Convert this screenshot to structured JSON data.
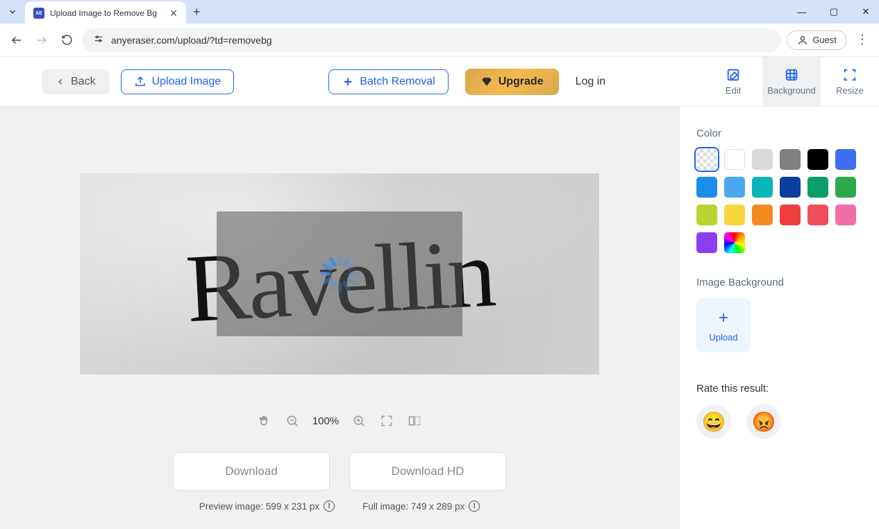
{
  "browser": {
    "tab_title": "Upload Image to Remove Bg",
    "favicon_text": "AE",
    "url": "anyeraser.com/upload/?td=removebg",
    "guest_label": "Guest"
  },
  "header": {
    "back_label": "Back",
    "upload_label": "Upload Image",
    "batch_label": "Batch Removal",
    "upgrade_label": "Upgrade",
    "login_label": "Log in",
    "tabs": {
      "edit": "Edit",
      "background": "Background",
      "resize": "Resize"
    }
  },
  "canvas": {
    "signature": "Ravellin",
    "zoom": "100%"
  },
  "downloads": {
    "download": "Download",
    "download_hd": "Download HD",
    "preview_label": "Preview image: 599 x 231 px",
    "full_label": "Full image: 749 x 289 px"
  },
  "sidebar": {
    "color_label": "Color",
    "colors": [
      {
        "name": "transparent",
        "css": "trans",
        "selected": true
      },
      {
        "name": "white",
        "css": "white",
        "bg": "#ffffff"
      },
      {
        "name": "light-gray",
        "bg": "#d9d9d9"
      },
      {
        "name": "dark-gray",
        "bg": "#808080"
      },
      {
        "name": "black",
        "bg": "#000000"
      },
      {
        "name": "royal-blue",
        "bg": "#3e6fef"
      },
      {
        "name": "dodger-blue",
        "bg": "#1c8de8"
      },
      {
        "name": "sky-blue",
        "bg": "#4aa8f0"
      },
      {
        "name": "teal",
        "bg": "#0bb6b6"
      },
      {
        "name": "navy",
        "bg": "#0c3c9e"
      },
      {
        "name": "emerald",
        "bg": "#0c9e6a"
      },
      {
        "name": "green",
        "bg": "#2ea84e"
      },
      {
        "name": "lime",
        "bg": "#b8d430"
      },
      {
        "name": "yellow",
        "bg": "#f7d63e"
      },
      {
        "name": "orange",
        "bg": "#f58a1f"
      },
      {
        "name": "red",
        "bg": "#ef3e3e"
      },
      {
        "name": "coral",
        "bg": "#ef4f5a"
      },
      {
        "name": "pink",
        "bg": "#ef6fa8"
      },
      {
        "name": "purple",
        "bg": "#8b3ef0"
      },
      {
        "name": "rainbow",
        "css": "rainbow"
      }
    ],
    "image_bg_label": "Image Background",
    "upload_label": "Upload",
    "rate_label": "Rate this result:",
    "emoji_good": "😄",
    "emoji_bad": "😡"
  }
}
